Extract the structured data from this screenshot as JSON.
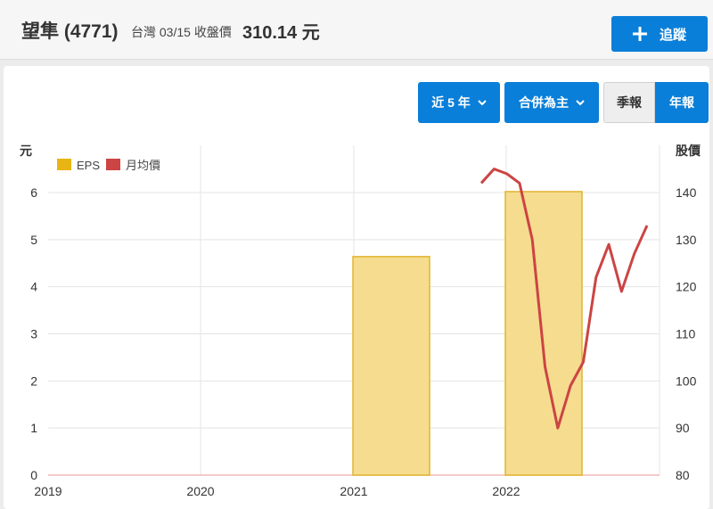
{
  "header": {
    "stock_name": "望隼 (4771)",
    "market_date": "台灣 03/15 收盤價",
    "price": "310.14 元",
    "follow_label": "追蹤"
  },
  "controls": {
    "period_label": "近 5 年",
    "consolidation_label": "合併為主",
    "quarterly_label": "季報",
    "annual_label": "年報"
  },
  "colors": {
    "accent": "#0a7fd9",
    "eps_bar": "#f5dc8f",
    "eps_bar_border": "#e2b52e",
    "eps_legend": "#e8b514",
    "price_line": "#cc4444"
  },
  "chart_data": {
    "type": "bar",
    "left_axis_label": "元",
    "right_axis_label": "股價",
    "x_ticks": [
      "2019",
      "2020",
      "2021",
      "2022"
    ],
    "left_ticks": [
      "0",
      "1",
      "2",
      "3",
      "4",
      "5",
      "6"
    ],
    "right_ticks": [
      "80",
      "90",
      "100",
      "110",
      "120",
      "130",
      "140"
    ],
    "ylim_left": [
      0,
      6
    ],
    "ylim_right": [
      80,
      140
    ],
    "legend": [
      "EPS",
      "月均價"
    ],
    "legend_position": "top-left",
    "grid": true,
    "eps": [
      {
        "year": "2021",
        "value": 4.64
      },
      {
        "year": "2022",
        "value": 6.02
      }
    ],
    "monthly_price": [
      {
        "month": "2022-01",
        "value": 142
      },
      {
        "month": "2022-02",
        "value": 145
      },
      {
        "month": "2022-03",
        "value": 144
      },
      {
        "month": "2022-04",
        "value": 142
      },
      {
        "month": "2022-05",
        "value": 130
      },
      {
        "month": "2022-06",
        "value": 103
      },
      {
        "month": "2022-07",
        "value": 90
      },
      {
        "month": "2022-08",
        "value": 99
      },
      {
        "month": "2022-09",
        "value": 104
      },
      {
        "month": "2022-10",
        "value": 122
      },
      {
        "month": "2022-11",
        "value": 129
      },
      {
        "month": "2022-12",
        "value": 119
      },
      {
        "month": "2023-01",
        "value": 127
      },
      {
        "month": "2023-02",
        "value": 133
      }
    ]
  }
}
